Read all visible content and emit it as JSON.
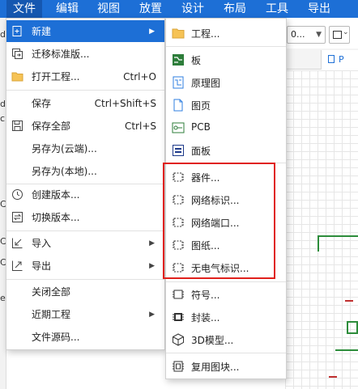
{
  "menubar": {
    "items": [
      "文件",
      "编辑",
      "视图",
      "放置",
      "设计",
      "布局",
      "工具",
      "导出"
    ],
    "active_index": 0,
    "accent": "#1d6fd6"
  },
  "background": {
    "zoom_value": "0...",
    "doc_tab_label": "P",
    "left_fragments": [
      "d",
      "cl",
      "d",
      "C",
      "C",
      "C",
      "el"
    ]
  },
  "file_menu": {
    "items": [
      {
        "label": "新建",
        "shortcut": "",
        "submenu": true,
        "icon": "new-doc-icon",
        "highlighted": true
      },
      {
        "label": "迁移标准版...",
        "shortcut": "",
        "submenu": false,
        "icon": "migrate-icon"
      },
      {
        "label": "打开工程...",
        "shortcut": "Ctrl+O",
        "submenu": false,
        "icon": "folder-icon"
      },
      {
        "label": "保存",
        "shortcut": "Ctrl+Shift+S",
        "submenu": false,
        "icon": ""
      },
      {
        "label": "保存全部",
        "shortcut": "Ctrl+S",
        "submenu": false,
        "icon": "save-icon"
      },
      {
        "label": "另存为(云端)...",
        "shortcut": "",
        "submenu": false,
        "icon": ""
      },
      {
        "label": "另存为(本地)...",
        "shortcut": "",
        "submenu": false,
        "icon": ""
      },
      {
        "label": "创建版本...",
        "shortcut": "",
        "submenu": false,
        "icon": "version-create-icon"
      },
      {
        "label": "切换版本...",
        "shortcut": "",
        "submenu": false,
        "icon": "version-switch-icon"
      },
      {
        "label": "导入",
        "shortcut": "",
        "submenu": true,
        "icon": "import-icon"
      },
      {
        "label": "导出",
        "shortcut": "",
        "submenu": true,
        "icon": "export-icon"
      },
      {
        "label": "关闭全部",
        "shortcut": "",
        "submenu": false,
        "icon": ""
      },
      {
        "label": "近期工程",
        "shortcut": "",
        "submenu": true,
        "icon": ""
      },
      {
        "label": "文件源码...",
        "shortcut": "",
        "submenu": false,
        "icon": ""
      }
    ]
  },
  "new_submenu": {
    "items": [
      {
        "label": "工程...",
        "icon": "folder-icon"
      },
      {
        "label": "板",
        "icon": "board-icon"
      },
      {
        "label": "原理图",
        "icon": "schematic-icon"
      },
      {
        "label": "图页",
        "icon": "sheet-icon"
      },
      {
        "label": "PCB",
        "icon": "pcb-icon"
      },
      {
        "label": "面板",
        "icon": "panel-icon"
      },
      {
        "label": "器件...",
        "icon": "device-icon"
      },
      {
        "label": "网络标识...",
        "icon": "net-label-icon"
      },
      {
        "label": "网络端口...",
        "icon": "net-port-icon"
      },
      {
        "label": "图纸...",
        "icon": "drawing-icon"
      },
      {
        "label": "无电气标识...",
        "icon": "non-electrical-icon"
      },
      {
        "label": "符号...",
        "icon": "symbol-icon"
      },
      {
        "label": "封装...",
        "icon": "footprint-icon"
      },
      {
        "label": "3D模型...",
        "icon": "model-3d-icon"
      },
      {
        "label": "复用图块...",
        "icon": "reuse-block-icon"
      }
    ],
    "highlight_color": "#e0201c"
  }
}
